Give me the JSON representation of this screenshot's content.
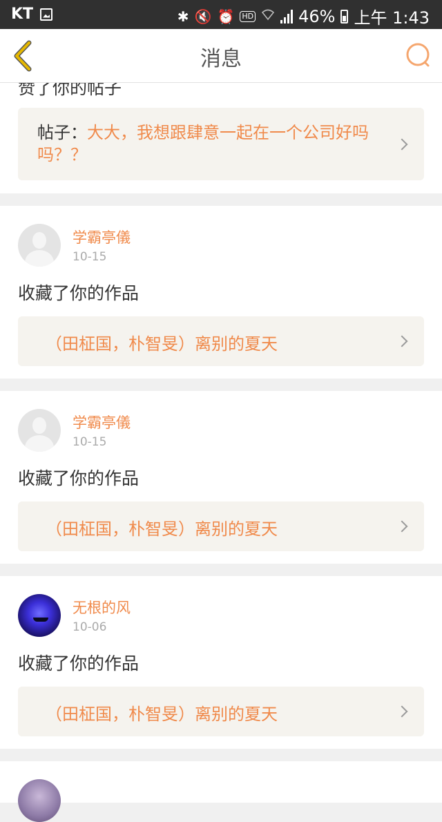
{
  "status_bar": {
    "carrier": "KT",
    "battery": "46%",
    "time": "上午 1:43",
    "hd_label": "HD",
    "icons": [
      "gallery-icon",
      "bluetooth-icon",
      "mute-icon",
      "alarm-icon",
      "hd-icon",
      "wifi-icon",
      "signal-icon",
      "battery-icon"
    ]
  },
  "header": {
    "title": "消息",
    "back_icon": "chevron-left-icon",
    "search_icon": "search-icon"
  },
  "first_card": {
    "partial_text": "赞了你的帖子",
    "post_label": "帖子：",
    "post_title": "大大，我想跟肆意一起在一个公司好吗吗？？"
  },
  "messages": [
    {
      "username": "学霸亭儀",
      "date": "10-15",
      "action": "收藏了你的作品",
      "work_title": "（田柾国，朴智旻）离别的夏天"
    },
    {
      "username": "学霸亭儀",
      "date": "10-15",
      "action": "收藏了你的作品",
      "work_title": "（田柾国，朴智旻）离别的夏天"
    },
    {
      "username": "无根的风",
      "date": "10-06",
      "action": "收藏了你的作品",
      "work_title": "（田柾国，朴智旻）离别的夏天"
    }
  ],
  "colors": {
    "accent": "#f08a4b",
    "back_icon": "#e6b800",
    "status_bar": "#303030"
  }
}
